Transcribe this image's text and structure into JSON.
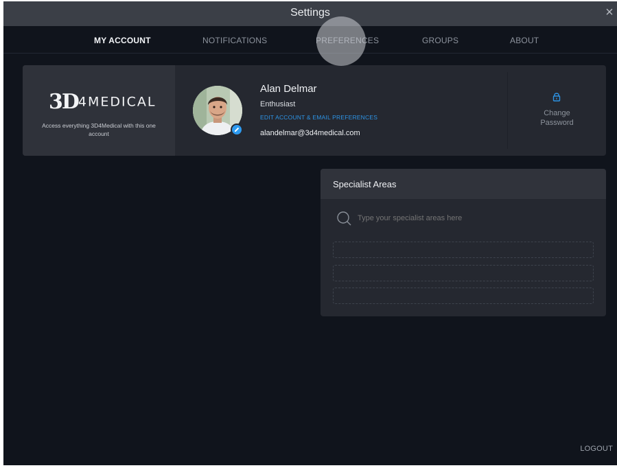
{
  "window": {
    "title": "Settings"
  },
  "tabs": [
    {
      "label": "MY ACCOUNT",
      "active": true
    },
    {
      "label": "NOTIFICATIONS",
      "active": false
    },
    {
      "label": "PREFERENCES",
      "active": false
    },
    {
      "label": "GROUPS",
      "active": false
    },
    {
      "label": "ABOUT",
      "active": false
    }
  ],
  "brand": {
    "logo_3d": "3D",
    "logo_rest": "4MEDICAL",
    "description": "Access everything 3D4Medical with this one account"
  },
  "profile": {
    "name": "Alan Delmar",
    "role": "Enthusiast",
    "edit_link": "EDIT ACCOUNT & EMAIL PREFERENCES",
    "email": "alandelmar@3d4medical.com"
  },
  "change_password": {
    "line1": "Change",
    "line2": "Password"
  },
  "specialist": {
    "title": "Specialist Areas",
    "placeholder": "Type your specialist areas here"
  },
  "logout": "LOGOUT",
  "colors": {
    "accent": "#2d94e6",
    "background": "#10141c",
    "card": "#252830"
  }
}
